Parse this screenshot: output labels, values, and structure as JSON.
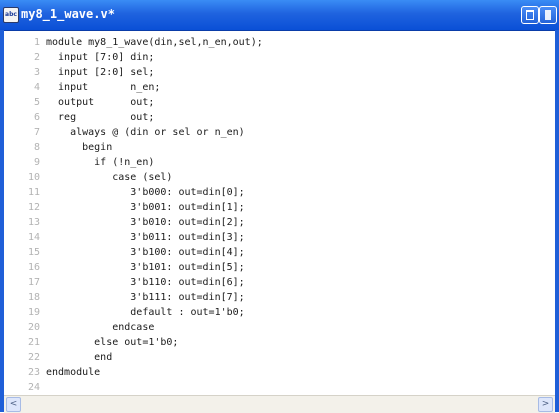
{
  "window": {
    "title": "my8_1_wave.v*"
  },
  "icons": {
    "app": "abc-text-file-icon",
    "restore": "restore-window-icon",
    "close": "close-window-icon",
    "scroll_left": "scroll-left-arrow-icon",
    "scroll_right": "scroll-right-arrow-icon"
  },
  "colors": {
    "titlebar": "#1f63df",
    "line_numbers": "#b3b3b3",
    "code_text": "#1b1b1b"
  },
  "scrollbar": {
    "left_arrow": "<",
    "right_arrow": ">"
  },
  "editor": {
    "lines": [
      {
        "n": "1",
        "text": "module my8_1_wave(din,sel,n_en,out);"
      },
      {
        "n": "2",
        "text": "  input [7:0] din;"
      },
      {
        "n": "3",
        "text": "  input [2:0] sel;"
      },
      {
        "n": "4",
        "text": "  input       n_en;"
      },
      {
        "n": "5",
        "text": "  output      out;"
      },
      {
        "n": "6",
        "text": "  reg         out;"
      },
      {
        "n": "7",
        "text": "    always @ (din or sel or n_en)"
      },
      {
        "n": "8",
        "text": "      begin"
      },
      {
        "n": "9",
        "text": "        if (!n_en)"
      },
      {
        "n": "10",
        "text": "           case (sel)"
      },
      {
        "n": "11",
        "text": "              3'b000: out=din[0];"
      },
      {
        "n": "12",
        "text": "              3'b001: out=din[1];"
      },
      {
        "n": "13",
        "text": "              3'b010: out=din[2];"
      },
      {
        "n": "14",
        "text": "              3'b011: out=din[3];"
      },
      {
        "n": "15",
        "text": "              3'b100: out=din[4];"
      },
      {
        "n": "16",
        "text": "              3'b101: out=din[5];"
      },
      {
        "n": "17",
        "text": "              3'b110: out=din[6];"
      },
      {
        "n": "18",
        "text": "              3'b111: out=din[7];"
      },
      {
        "n": "19",
        "text": "              default : out=1'b0;"
      },
      {
        "n": "20",
        "text": "           endcase"
      },
      {
        "n": "21",
        "text": "        else out=1'b0;"
      },
      {
        "n": "22",
        "text": "        end"
      },
      {
        "n": "23",
        "text": "endmodule"
      },
      {
        "n": "24",
        "text": ""
      }
    ]
  }
}
